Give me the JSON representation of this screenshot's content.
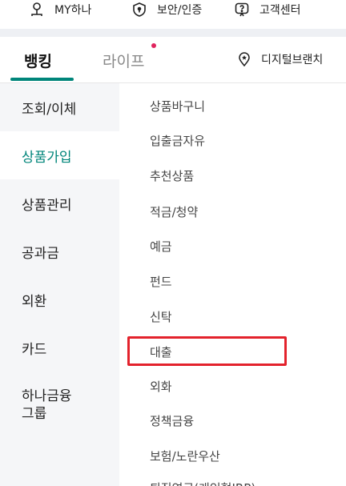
{
  "top_links": [
    {
      "label": "MY하나",
      "icon": "person-icon"
    },
    {
      "label": "보안/인증",
      "icon": "shield-icon"
    },
    {
      "label": "고객센터",
      "icon": "chat-question-icon"
    }
  ],
  "tabs": {
    "banking": "뱅킹",
    "life": "라이프",
    "digital_branch": "디지털브랜치"
  },
  "left_menu": [
    "조회/이체",
    "상품가입",
    "상품관리",
    "공과금",
    "외환",
    "카드",
    "하나금융\n그룹"
  ],
  "right_menu": [
    "상품바구니",
    "입출금자유",
    "추천상품",
    "적금/청약",
    "예금",
    "펀드",
    "신탁",
    "대출",
    "외화",
    "정책금융",
    "보험/노란우산",
    "퇴직연금(개인형IRP)"
  ],
  "colors": {
    "accent": "#00857a",
    "highlight": "#e3222c",
    "dot": "#e0245e"
  }
}
